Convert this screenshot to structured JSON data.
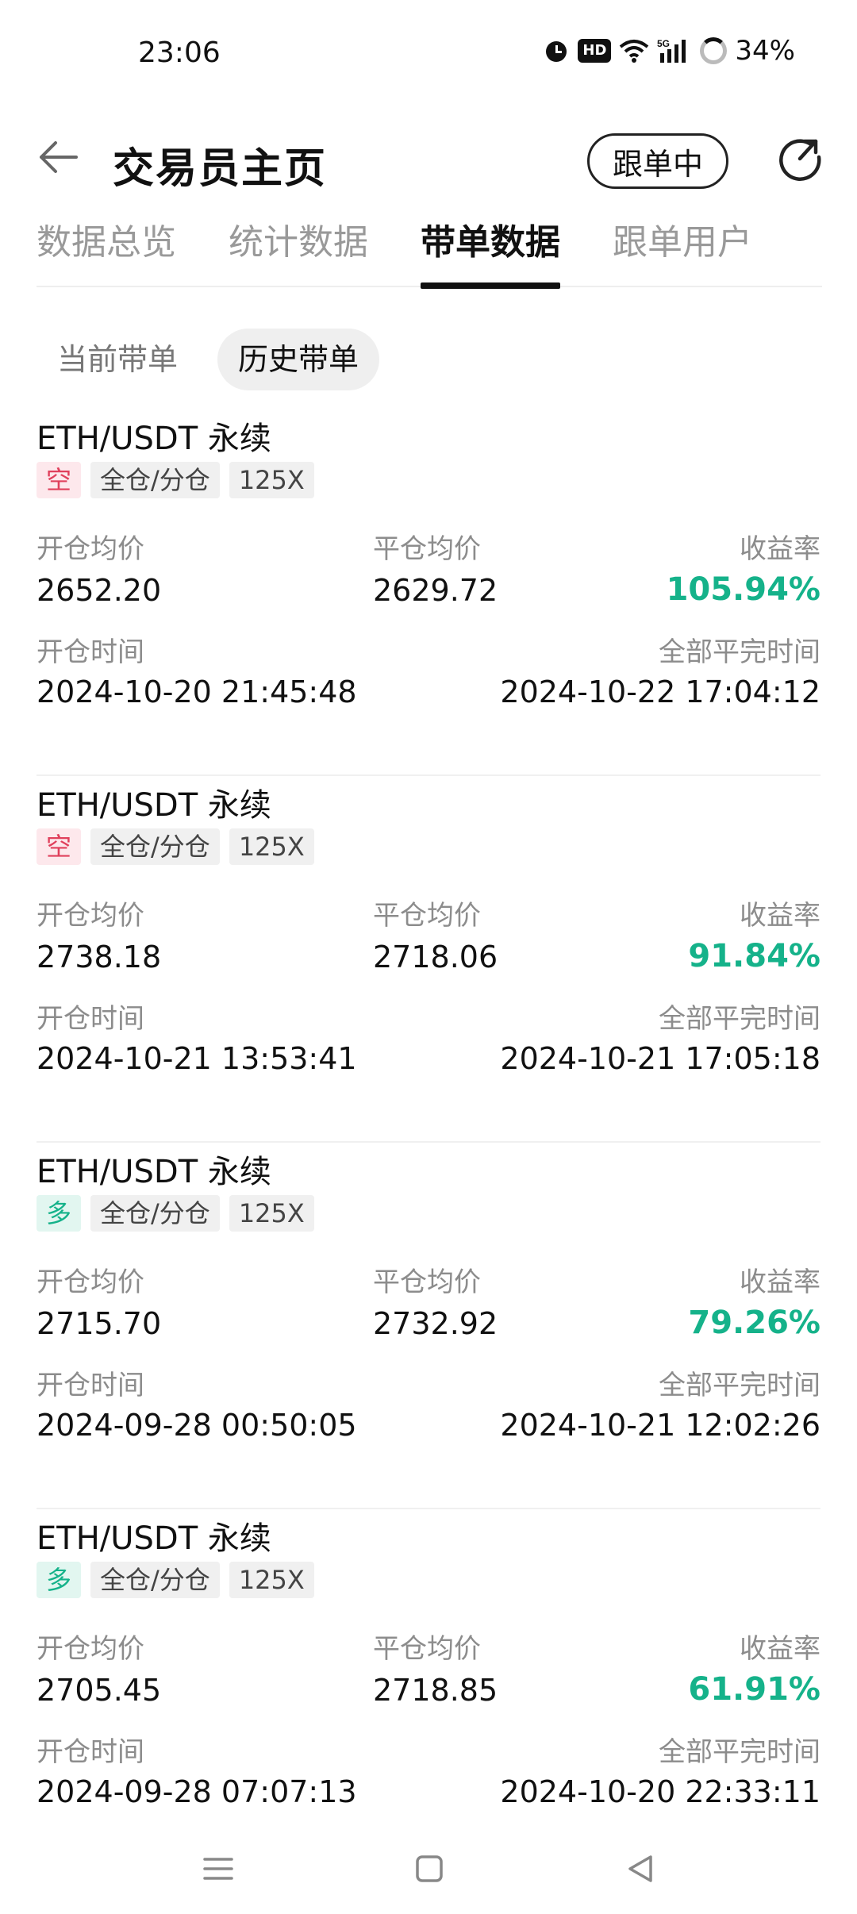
{
  "status": {
    "time": "23:06",
    "battery": "34%",
    "network": "5G"
  },
  "header": {
    "title": "交易员主页",
    "follow_label": "跟单中"
  },
  "tabs": [
    {
      "label": "数据总览"
    },
    {
      "label": "统计数据"
    },
    {
      "label": "带单数据"
    },
    {
      "label": "跟单用户"
    }
  ],
  "subtabs": [
    {
      "label": "当前带单"
    },
    {
      "label": "历史带单"
    }
  ],
  "labels": {
    "open_avg": "开仓均价",
    "close_avg": "平仓均价",
    "roi": "收益率",
    "open_time": "开仓时间",
    "close_time": "全部平完时间"
  },
  "orders": [
    {
      "pair": "ETH/USDT 永续",
      "side": "空",
      "margin": "全仓/分仓",
      "leverage": "125X",
      "open_price": "2652.20",
      "close_price": "2629.72",
      "roi": "105.94%",
      "open_time": "2024-10-20 21:45:48",
      "close_time": "2024-10-22 17:04:12"
    },
    {
      "pair": "ETH/USDT 永续",
      "side": "空",
      "margin": "全仓/分仓",
      "leverage": "125X",
      "open_price": "2738.18",
      "close_price": "2718.06",
      "roi": "91.84%",
      "open_time": "2024-10-21 13:53:41",
      "close_time": "2024-10-21 17:05:18"
    },
    {
      "pair": "ETH/USDT 永续",
      "side": "多",
      "margin": "全仓/分仓",
      "leverage": "125X",
      "open_price": "2715.70",
      "close_price": "2732.92",
      "roi": "79.26%",
      "open_time": "2024-09-28 00:50:05",
      "close_time": "2024-10-21 12:02:26"
    },
    {
      "pair": "ETH/USDT 永续",
      "side": "多",
      "margin": "全仓/分仓",
      "leverage": "125X",
      "open_price": "2705.45",
      "close_price": "2718.85",
      "roi": "61.91%",
      "open_time": "2024-09-28 07:07:13",
      "close_time": "2024-10-20 22:33:11"
    }
  ],
  "colors": {
    "positive": "#15b28a",
    "short": "#e0405c",
    "long": "#15b28a"
  }
}
